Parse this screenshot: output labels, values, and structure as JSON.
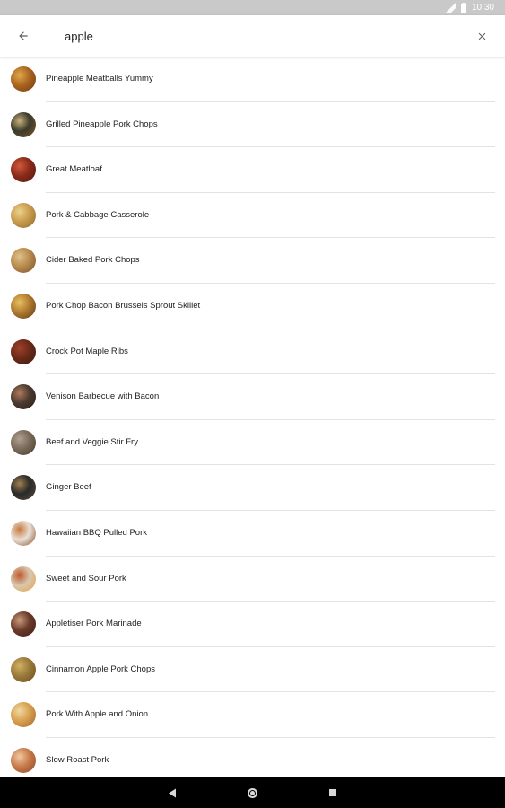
{
  "status_bar": {
    "time": "10:30"
  },
  "search": {
    "query": "apple"
  },
  "results": [
    {
      "title": "Pineapple Meatballs Yummy",
      "colors": [
        "#a9651f",
        "#e0a94a",
        "#6e3a12"
      ]
    },
    {
      "title": "Grilled Pineapple Pork Chops",
      "colors": [
        "#3c3a2c",
        "#c8b07a",
        "#7a5a2e"
      ]
    },
    {
      "title": "Great Meatloaf",
      "colors": [
        "#8a2a1a",
        "#d15a3a",
        "#4a1a10"
      ]
    },
    {
      "title": "Pork & Cabbage Casserole",
      "colors": [
        "#c99b4e",
        "#e9d28a",
        "#8e6a2a"
      ]
    },
    {
      "title": "Cider Baked Pork Chops",
      "colors": [
        "#b88a4e",
        "#e0c08a",
        "#7a5228"
      ]
    },
    {
      "title": "Pork Chop Bacon Brussels Sprout Skillet",
      "colors": [
        "#b07a2e",
        "#e8c060",
        "#5a3a18"
      ]
    },
    {
      "title": "Crock Pot Maple Ribs",
      "colors": [
        "#6a2a18",
        "#a0402a",
        "#3a1a10"
      ]
    },
    {
      "title": "Venison Barbecue with Bacon",
      "colors": [
        "#4a3a30",
        "#b07a5a",
        "#2a2018"
      ]
    },
    {
      "title": "Beef and Veggie Stir Fry",
      "colors": [
        "#7a6a5a",
        "#b0a090",
        "#4a3a2a"
      ]
    },
    {
      "title": "Ginger Beef",
      "colors": [
        "#2a2a2a",
        "#a08050",
        "#5a4a3a"
      ]
    },
    {
      "title": "Hawaiian BBQ Pulled Pork",
      "colors": [
        "#e8e0d8",
        "#c8783a",
        "#8a4a22"
      ]
    },
    {
      "title": "Sweet and Sour Pork",
      "colors": [
        "#d8c8b0",
        "#c0582a",
        "#e8a040"
      ]
    },
    {
      "title": "Appletiser Pork Marinade",
      "colors": [
        "#6a3a2a",
        "#c89a7a",
        "#3a2018"
      ]
    },
    {
      "title": "Cinnamon Apple Pork Chops",
      "colors": [
        "#9a7a3a",
        "#d0b060",
        "#6a4a1a"
      ]
    },
    {
      "title": "Pork With Apple and Onion",
      "colors": [
        "#d8a050",
        "#f0d8a0",
        "#a06a2a"
      ]
    },
    {
      "title": "Slow Roast Pork",
      "colors": [
        "#c87a4a",
        "#f0c8a0",
        "#8a4a2a"
      ]
    }
  ],
  "icons": {
    "back": "arrow-back-icon",
    "clear": "close-icon",
    "nav_back": "triangle-back-icon",
    "nav_home": "circle-home-icon",
    "nav_recents": "square-recents-icon"
  }
}
